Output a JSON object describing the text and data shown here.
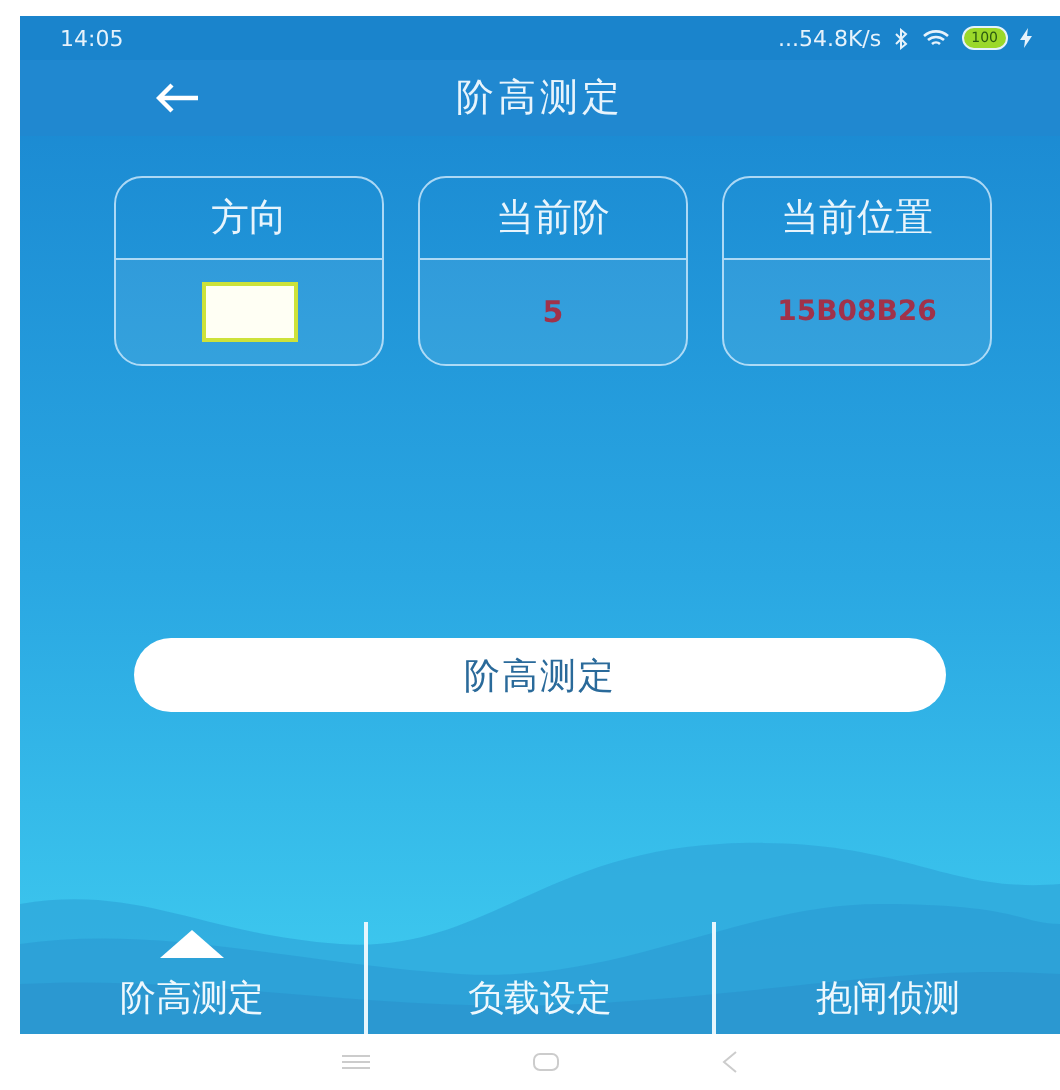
{
  "status_bar": {
    "time": "14:05",
    "network_speed": "...54.8K/s",
    "battery": "100"
  },
  "title_bar": {
    "title": "阶高测定"
  },
  "cards": [
    {
      "kind": "indicator",
      "label": "方向"
    },
    {
      "kind": "value",
      "label": "当前阶",
      "value": "5"
    },
    {
      "kind": "value",
      "label": "当前位置",
      "value": "15B08B26"
    }
  ],
  "action_button": {
    "label": "阶高测定"
  },
  "tabs": [
    {
      "label": "阶高测定",
      "selected": true
    },
    {
      "label": "负载设定",
      "selected": false
    },
    {
      "label": "抱闸侦测",
      "selected": false
    }
  ]
}
